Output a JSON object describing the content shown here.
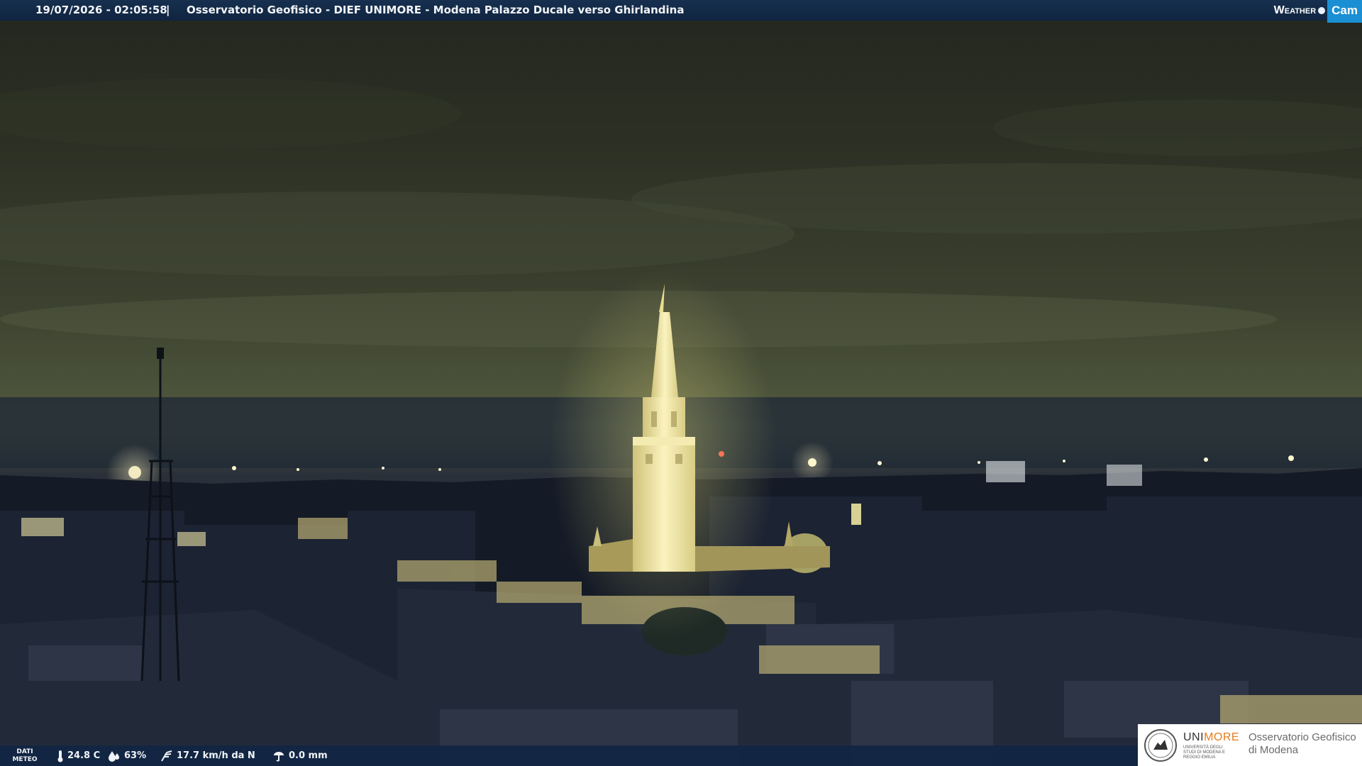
{
  "header": {
    "timestamp": "19/07/2026 - 02:05:58",
    "separator": "|",
    "title": "Osservatorio Geofisico - DIEF UNIMORE - Modena Palazzo Ducale verso Ghirlandina"
  },
  "brand": {
    "weather": "Weather",
    "cam": "Cam"
  },
  "weather_bar": {
    "label_line1": "DATI",
    "label_line2": "METEO",
    "temperature": "24.8 C",
    "humidity": "63%",
    "wind": "17.7 km/h da N",
    "rain": "0.0 mm",
    "icons": [
      "thermometer-icon",
      "humidity-drop-icon",
      "wind-icon",
      "rain-gauge-icon"
    ]
  },
  "logo": {
    "uni_part1": "UNI",
    "uni_part2": "MORE",
    "uni_sub": "UNIVERSITÀ DEGLI STUDI DI MODENA E REGGIO EMILIA",
    "observatory_line1": "Osservatorio Geofisico",
    "observatory_line2": "di Modena"
  },
  "colors": {
    "banner": "#17304f",
    "cam_badge": "#1a8fd4",
    "more_orange": "#e67c1a",
    "tower_light": "#f5eeb4"
  }
}
